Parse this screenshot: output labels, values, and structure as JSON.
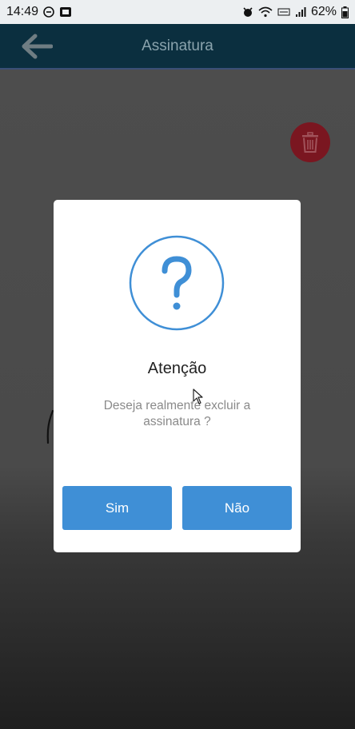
{
  "status_bar": {
    "time": "14:49",
    "battery": "62%"
  },
  "header": {
    "title": "Assinatura"
  },
  "dialog": {
    "title": "Atenção",
    "message": "Deseja realmente excluir a assinatura ?",
    "confirm_label": "Sim",
    "cancel_label": "Não"
  },
  "icons": {
    "back": "arrow-left-icon",
    "delete": "trash-icon",
    "question": "question-mark-icon"
  },
  "colors": {
    "appbar": "#0b2f3f",
    "accent": "#3f8fd6",
    "delete_button": "#7a1620",
    "dialog_bg": "#ffffff"
  }
}
